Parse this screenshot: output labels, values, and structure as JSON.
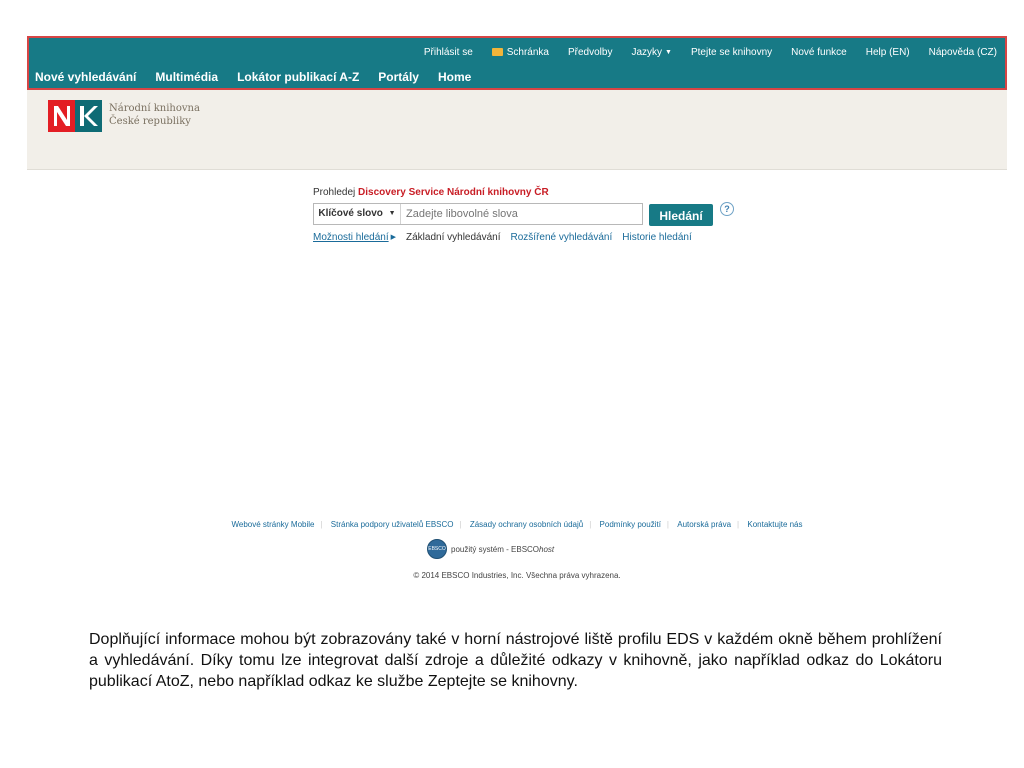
{
  "utility_links": [
    {
      "label": "Přihlásit se"
    },
    {
      "label": "Schránka",
      "icon": "folder-icon"
    },
    {
      "label": "Předvolby"
    },
    {
      "label": "Jazyky",
      "icon": "caret-down-icon"
    },
    {
      "label": "Ptejte se knihovny"
    },
    {
      "label": "Nové funkce"
    },
    {
      "label": "Help (EN)"
    },
    {
      "label": "Nápověda (CZ)"
    }
  ],
  "main_nav": [
    {
      "label": "Nové vyhledávání"
    },
    {
      "label": "Multimédia"
    },
    {
      "label": "Lokátor publikací A-Z"
    },
    {
      "label": "Portály"
    },
    {
      "label": "Home"
    }
  ],
  "brand": {
    "logo_letters": "NK",
    "name_line1": "Národní knihovna",
    "name_line2": "České republiky"
  },
  "search": {
    "prompt_prefix": "Prohledej",
    "prompt_highlight": "Discovery Service Národní knihovny ČR",
    "field_type": "Klíčové slovo",
    "placeholder": "Zadejte libovolné slova",
    "button_label": "Hledání",
    "help_symbol": "?",
    "links": [
      {
        "label": "Možnosti hledání"
      },
      {
        "label": "Základní vyhledávání"
      },
      {
        "label": "Rozšířené vyhledávání"
      },
      {
        "label": "Historie hledání"
      }
    ]
  },
  "footer": {
    "links": [
      {
        "label": "Webové stránky Mobile"
      },
      {
        "label": "Stránka podpory uživatelů EBSCO"
      },
      {
        "label": "Zásady ochrany osobních údajů"
      },
      {
        "label": "Podmínky použití"
      },
      {
        "label": "Autorská práva"
      },
      {
        "label": "Kontaktujte nás"
      }
    ],
    "powered_prefix": "použitý systém - EBSCO",
    "powered_host": "host",
    "ebsco_badge": "EBSCO",
    "copyright": "© 2014 EBSCO Industries, Inc. Všechna práva vyhrazena."
  },
  "caption": "Doplňující informace mohou být zobrazovány také v horní nástrojové liště profilu EDS v každém okně během prohlížení a vyhledávání. Díky tomu lze integrovat další zdroje a důležité odkazy v knihovně, jako například odkaz do Lokátoru publikací AtoZ, nebo například odkaz ke službe Zeptejte se knihovny.",
  "colors": {
    "header": "#177a86",
    "header_outline": "#d64545",
    "brand_background": "#f2efe9",
    "logo_red": "#e31e24",
    "logo_teal": "#0e6b75",
    "accent_red": "#c81d25",
    "link_blue": "#1a6b9a"
  }
}
